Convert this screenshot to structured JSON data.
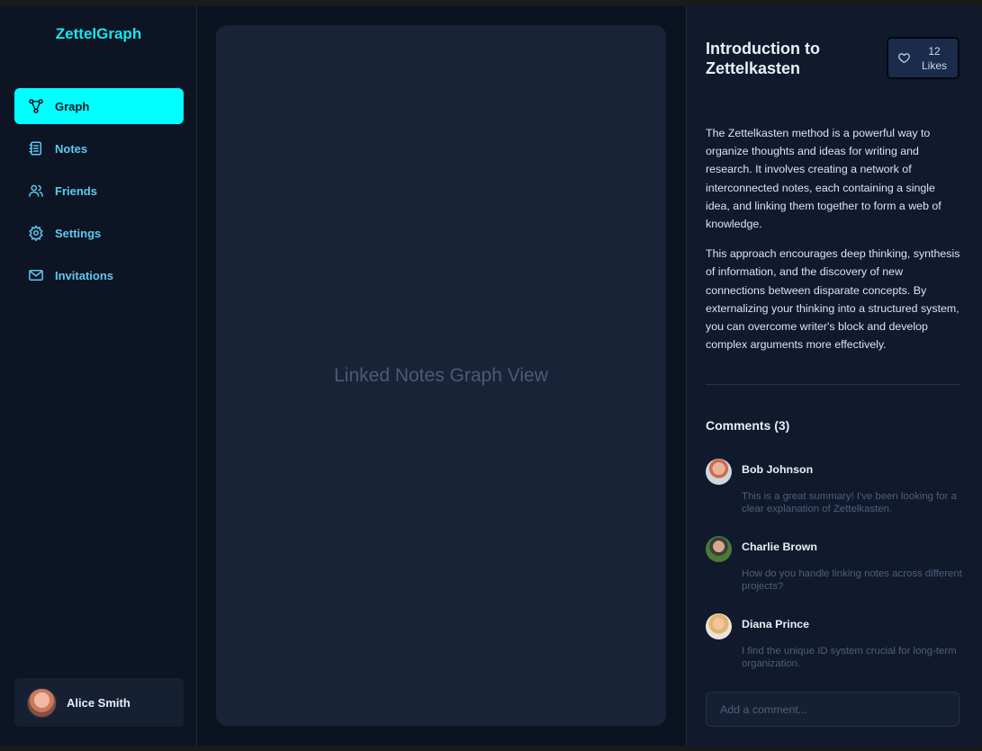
{
  "app": {
    "brand": "ZettelGraph"
  },
  "sidebar": {
    "items": [
      {
        "label": "Graph",
        "icon": "graph-icon",
        "active": true
      },
      {
        "label": "Notes",
        "icon": "notebook-icon",
        "active": false
      },
      {
        "label": "Friends",
        "icon": "users-icon",
        "active": false
      },
      {
        "label": "Settings",
        "icon": "gear-icon",
        "active": false
      },
      {
        "label": "Invitations",
        "icon": "mail-icon",
        "active": false
      }
    ],
    "user": {
      "name": "Alice Smith"
    }
  },
  "main": {
    "placeholder": "Linked Notes Graph View"
  },
  "note": {
    "title": "Introduction to Zettelkasten",
    "likes_count": "12",
    "likes_label": "Likes",
    "paragraphs": [
      "The Zettelkasten method is a powerful way to organize thoughts and ideas for writing and research. It involves creating a network of interconnected notes, each containing a single idea, and linking them together to form a web of knowledge.",
      "This approach encourages deep thinking, synthesis of information, and the discovery of new connections between disparate concepts. By externalizing your thinking into a structured system, you can overcome writer's block and develop complex arguments more effectively."
    ]
  },
  "comments": {
    "title": "Comments (3)",
    "items": [
      {
        "author": "Bob Johnson",
        "text": "This is a great summary! I've been looking for a clear explanation of Zettelkasten."
      },
      {
        "author": "Charlie Brown",
        "text": "How do you handle linking notes across different projects?"
      },
      {
        "author": "Diana Prince",
        "text": "I find the unique ID system crucial for long-term organization."
      }
    ],
    "input_placeholder": "Add a comment..."
  },
  "colors": {
    "accent": "#00ffff",
    "brand": "#17e6ee",
    "nav_text": "#5fc8f0",
    "background": "#0b1220"
  }
}
